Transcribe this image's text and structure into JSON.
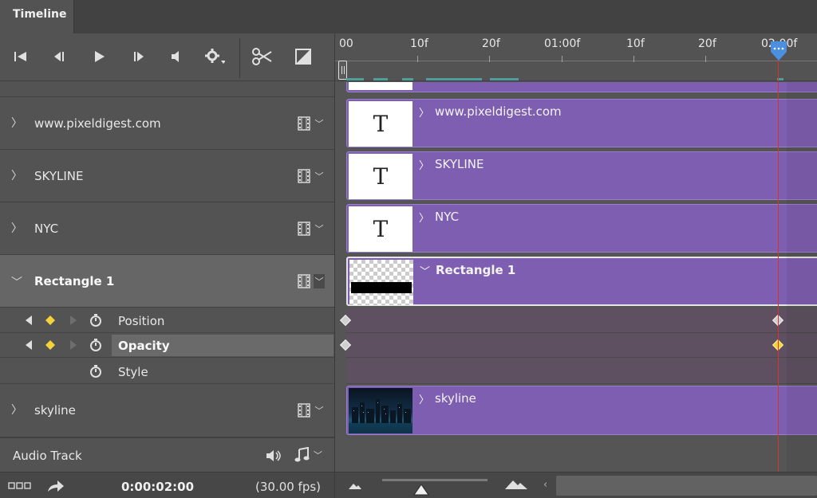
{
  "tab": {
    "title": "Timeline"
  },
  "controls": {
    "items": [
      {
        "name": "go-to-first-frame-icon",
        "glyph": "⏮"
      },
      {
        "name": "previous-frame-icon",
        "glyph": "◀"
      },
      {
        "name": "play-icon",
        "glyph": "▶"
      },
      {
        "name": "next-frame-icon",
        "glyph": "▶"
      },
      {
        "name": "mute-audio-icon",
        "glyph": "◀"
      },
      {
        "name": "settings-gear-icon",
        "glyph": "⚙"
      },
      {
        "name": "split-scissors-icon",
        "glyph": "✂"
      },
      {
        "name": "transition-icon",
        "glyph": "◪"
      }
    ]
  },
  "ruler": {
    "labels": [
      "00",
      "10f",
      "20f",
      "01:00f",
      "10f",
      "20f",
      "02:00f"
    ]
  },
  "layers": [
    {
      "name": "www.pixeldigest.com",
      "type": "text",
      "expanded": false
    },
    {
      "name": "SKYLINE",
      "type": "text",
      "expanded": false
    },
    {
      "name": "NYC",
      "type": "text",
      "expanded": false
    },
    {
      "name": "Rectangle 1",
      "type": "shape",
      "expanded": true,
      "selected": true
    },
    {
      "name": "skyline",
      "type": "image",
      "expanded": false
    }
  ],
  "properties": [
    {
      "name": "Position",
      "has_keyframes": true,
      "highlighted": false
    },
    {
      "name": "Opacity",
      "has_keyframes": true,
      "highlighted": true
    },
    {
      "name": "Style",
      "has_keyframes": false,
      "highlighted": false
    }
  ],
  "audio": {
    "label": "Audio Track"
  },
  "bottom": {
    "timecode": "0:00:02:00",
    "fps": "(30.00 fps)"
  },
  "colors": {
    "clip": "#7e5eb0",
    "playhead": "#d8322e",
    "keyframe_selected": "#f5d13a",
    "work_area": "#4c9f9a"
  }
}
